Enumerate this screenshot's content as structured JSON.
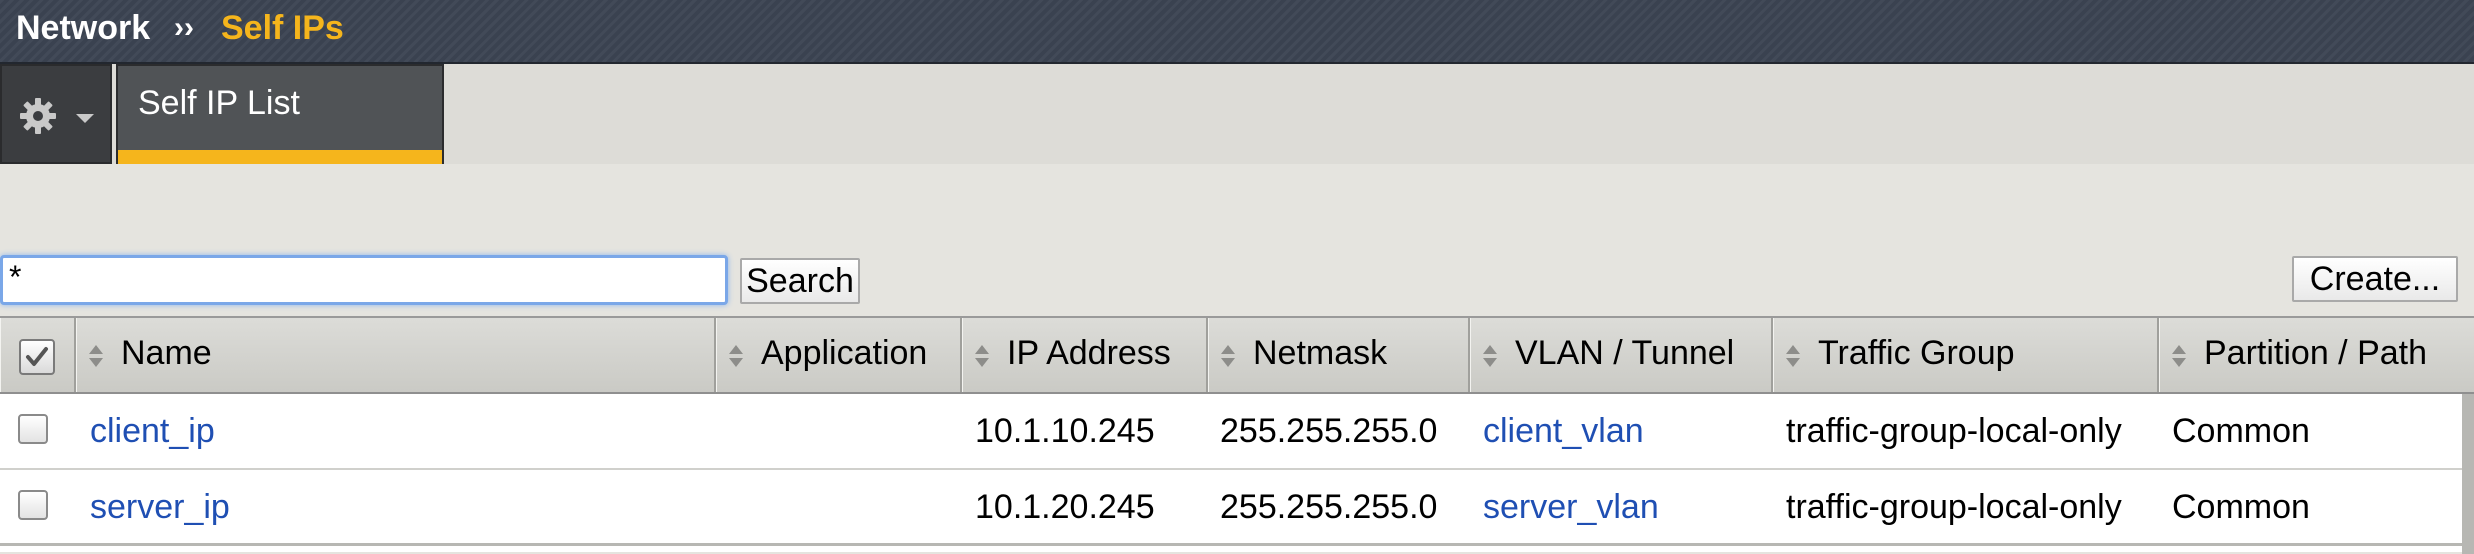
{
  "breadcrumb": {
    "section": "Network",
    "separator": "››",
    "current": "Self IPs"
  },
  "tabs": {
    "gear_icon": "gear-icon",
    "active_tab": "Self IP List"
  },
  "toolbar": {
    "search_value": "*",
    "search_button": "Search",
    "create_button": "Create..."
  },
  "table": {
    "columns": [
      "Name",
      "Application",
      "IP Address",
      "Netmask",
      "VLAN / Tunnel",
      "Traffic Group",
      "Partition / Path"
    ],
    "rows": [
      {
        "name": "client_ip",
        "application": "",
        "ip_address": "10.1.10.245",
        "netmask": "255.255.255.0",
        "vlan": "client_vlan",
        "traffic_group": "traffic-group-local-only",
        "partition": "Common"
      },
      {
        "name": "server_ip",
        "application": "",
        "ip_address": "10.1.20.245",
        "netmask": "255.255.255.0",
        "vlan": "server_vlan",
        "traffic_group": "traffic-group-local-only",
        "partition": "Common"
      }
    ]
  },
  "colors": {
    "accent": "#f5b51c",
    "link": "#1f4fb3",
    "header_bar": "#3a4250"
  }
}
